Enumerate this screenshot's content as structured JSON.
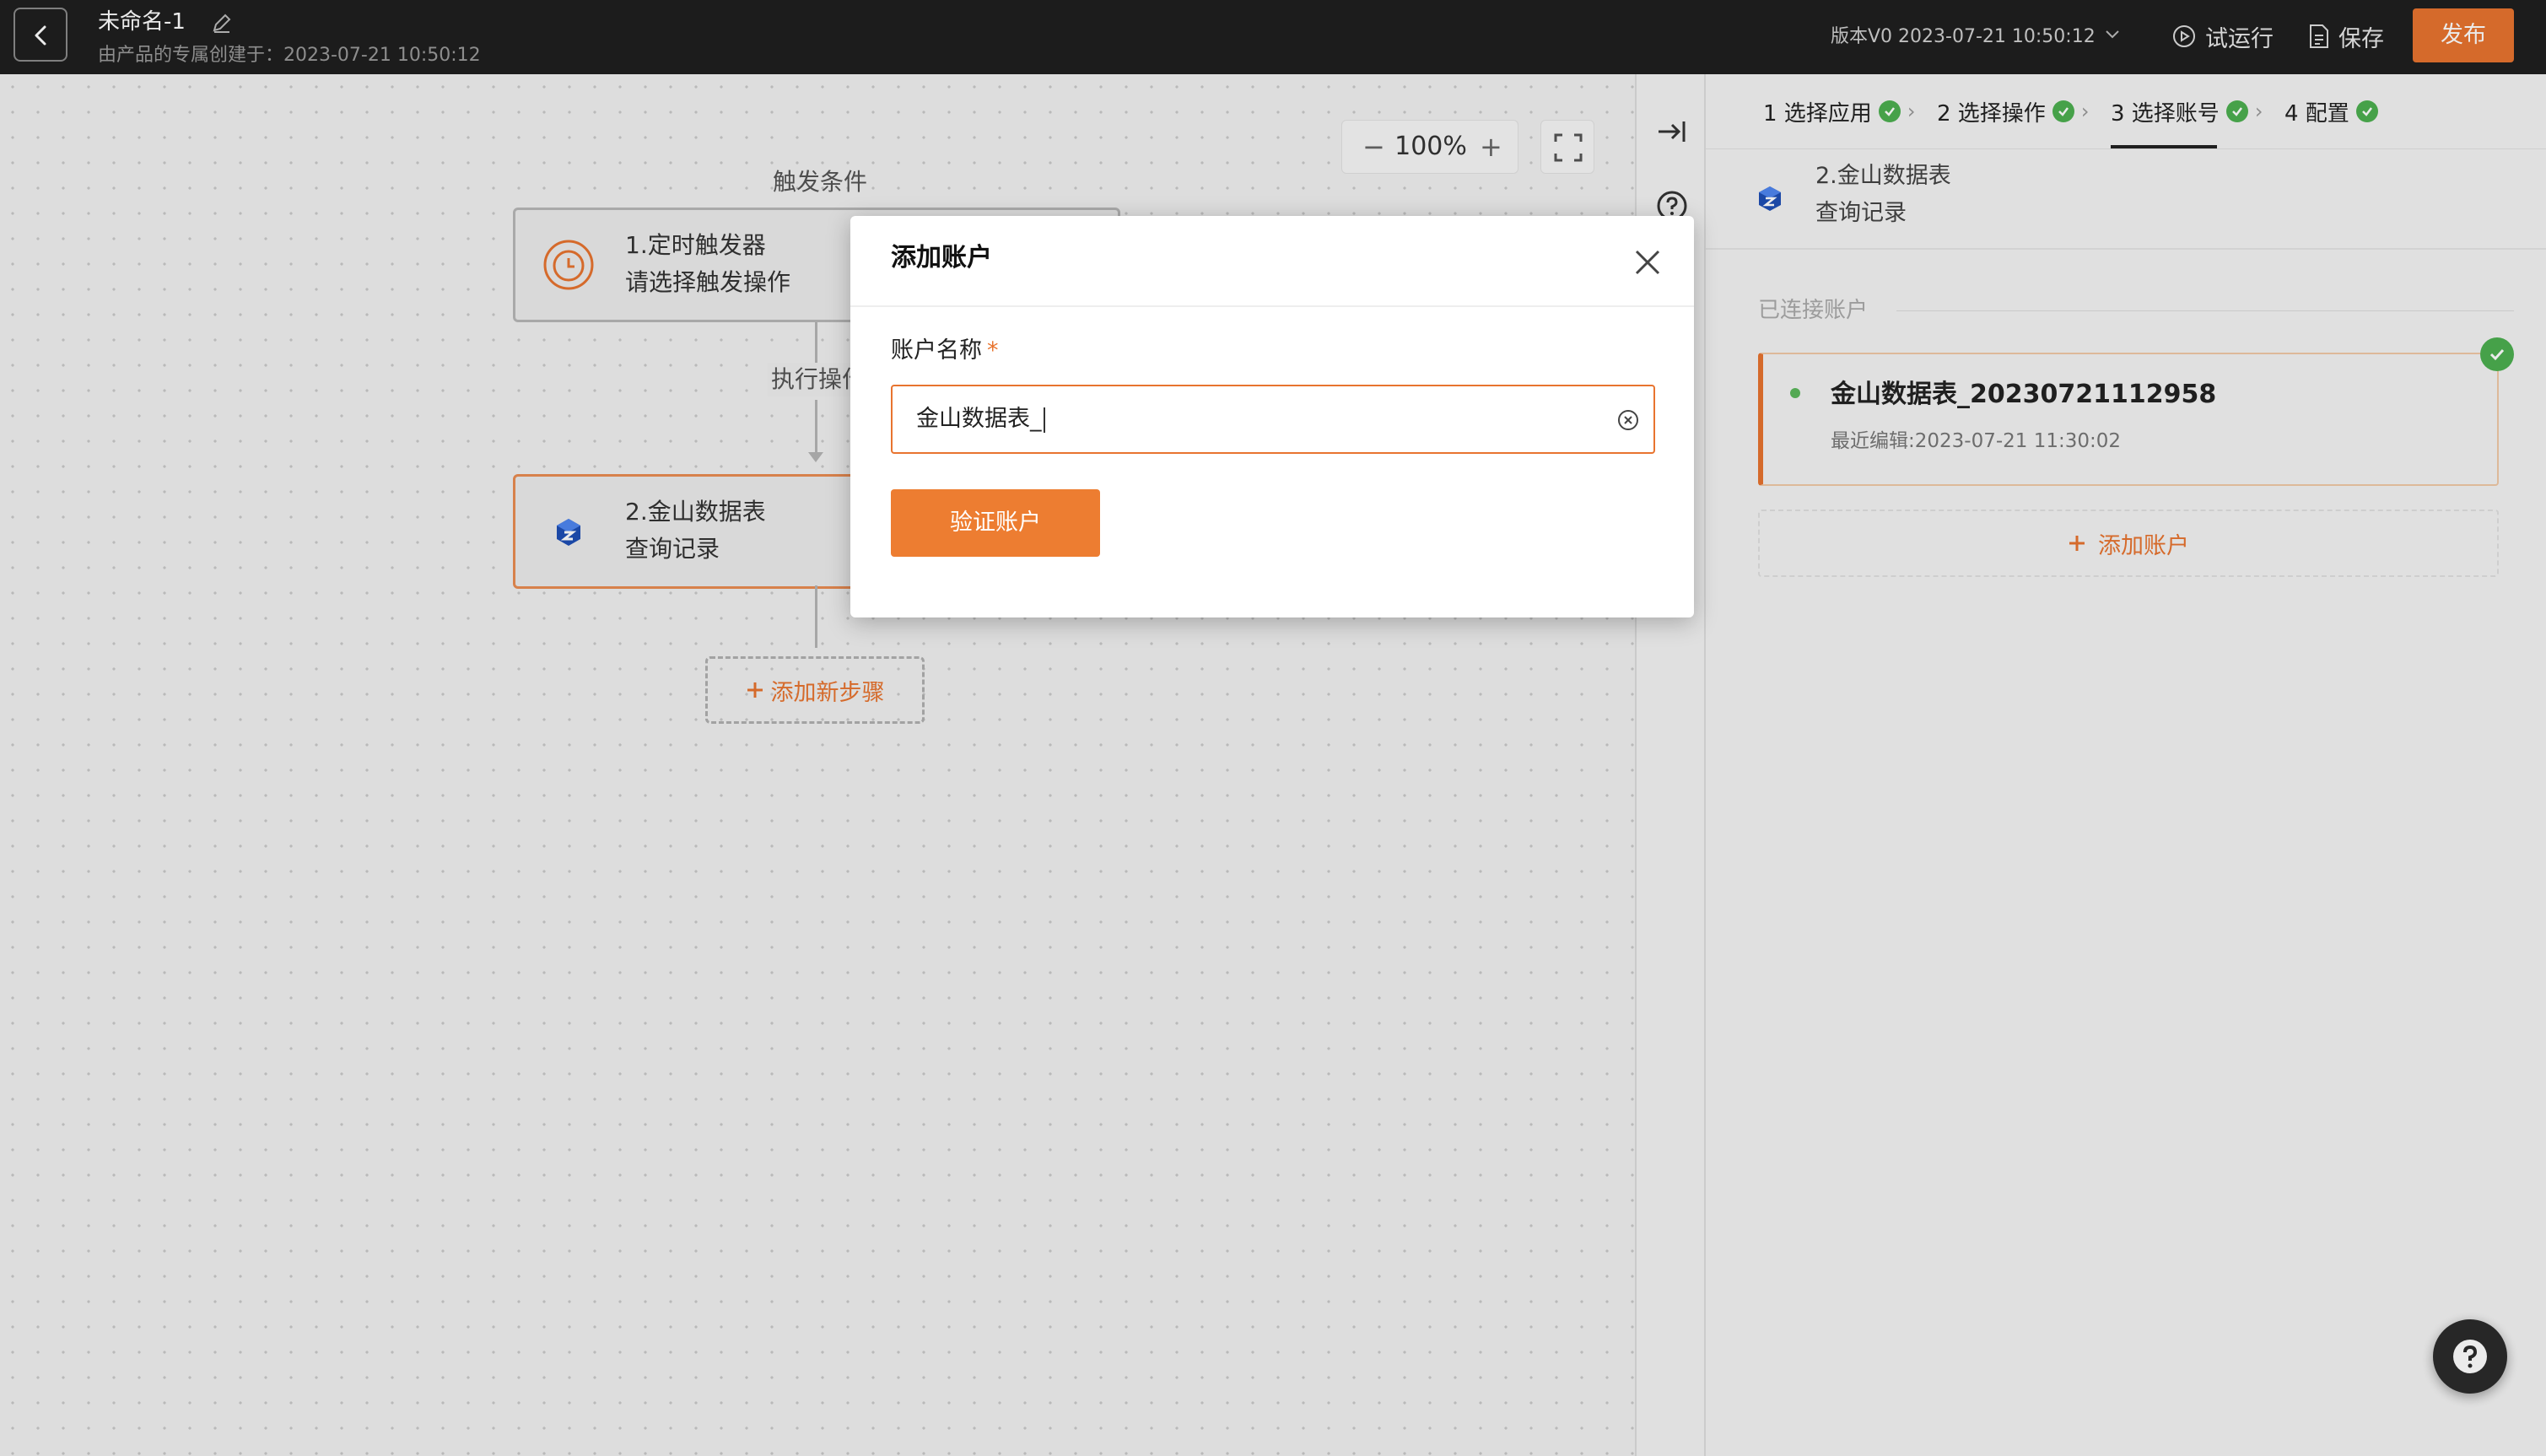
{
  "header": {
    "title": "未命名-1",
    "subtitle": "由产品的专属创建于：2023-07-21 10:50:12",
    "version": "版本V0 2023-07-21 10:50:12",
    "trial_run_label": "试运行",
    "save_label": "保存",
    "publish_label": "发布"
  },
  "canvas": {
    "zoom_level": "100%",
    "trigger_section_label": "触发条件",
    "action_section_label": "执行操作",
    "trigger_node": {
      "line1": "1.定时触发器",
      "line2": "请选择触发操作"
    },
    "action_node": {
      "line1": "2.金山数据表",
      "line2": "查询记录"
    },
    "add_step_label": "添加新步骤"
  },
  "panel": {
    "steps": [
      {
        "label": "1 选择应用"
      },
      {
        "label": "2 选择操作"
      },
      {
        "label": "3 选择账号"
      },
      {
        "label": "4 配置"
      }
    ],
    "app": {
      "line1": "2.金山数据表",
      "line2": "查询记录"
    },
    "connected_label": "已连接账户",
    "account": {
      "name": "金山数据表_20230721112958",
      "edited": "最近编辑:2023-07-21 11:30:02"
    },
    "add_account_label": "添加账户"
  },
  "modal": {
    "title": "添加账户",
    "field_label": "账户名称",
    "required_mark": "*",
    "field_value": "金山数据表_",
    "verify_label": "验证账户"
  },
  "colors": {
    "accent": "#e8742f",
    "header_bg": "#1f1f1f",
    "success": "#4caf50"
  },
  "icons": [
    "back-icon",
    "edit-icon",
    "chevron-down-icon",
    "play-icon",
    "document-icon",
    "clock-icon",
    "cube-icon",
    "fullscreen-icon",
    "collapse-panel-icon",
    "help-icon",
    "check-icon",
    "plus-icon",
    "close-icon",
    "clear-icon"
  ]
}
